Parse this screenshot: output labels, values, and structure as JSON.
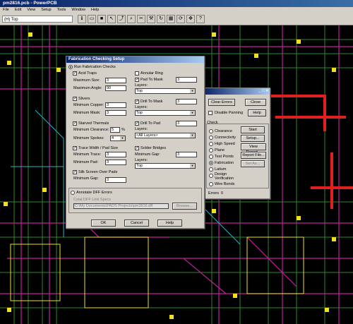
{
  "app": {
    "title": "pm2816.pcb - PowerPCB"
  },
  "menu": [
    "File",
    "Edit",
    "View",
    "Setup",
    "Tools",
    "Window",
    "Help"
  ],
  "toolbar": {
    "layer": "(H) Top"
  },
  "fab": {
    "title": "Fabrication Checking Setup",
    "run_label": "Run Fabrication Checks",
    "acid": {
      "label": "Acid Traps",
      "size_label": "Maximum Size:",
      "size": "3",
      "angle_label": "Maximum Angle:",
      "angle": "90"
    },
    "annular": {
      "label": "Annular Ring"
    },
    "pad_to_mask": {
      "label": "Pad To Mask",
      "value": "3",
      "layers_label": "Layers:",
      "layer": "Top"
    },
    "slivers": {
      "label": "Slivers",
      "copper_label": "Minimum Copper:",
      "copper": "3",
      "mask_label": "Minimum Mask:",
      "mask": "3"
    },
    "drill_to_mask": {
      "label": "Drill To Mask",
      "value": "3",
      "layers_label": "Layers:",
      "layer": "Top"
    },
    "starved": {
      "label": "Starved Thermals",
      "clear_label": "Minimum Clearance:",
      "clear": "5",
      "pct": "%",
      "spokes_label": "Minimum Spokes:",
      "spokes": "4"
    },
    "drill_to_pad": {
      "label": "Drill To Pad",
      "value": "3",
      "layers_label": "Layers:",
      "layer": "<All Layers>"
    },
    "trace": {
      "label": "Trace Width / Pad Size",
      "trace_label": "Minimum Trace:",
      "trace": "3",
      "pad_label": "Minimum Pad:",
      "pad": "3"
    },
    "bridges": {
      "label": "Solder Bridges",
      "gap_label": "Minimum Gap:",
      "gap": "3",
      "layers_label": "Layers:",
      "layer": "Top"
    },
    "silk": {
      "label": "Silk Screen Over Pads",
      "gap_label": "Minimum Gap:",
      "gap": "3"
    },
    "annotate_label": "Annotate DFF Errors",
    "dff_label": "Cstal DFF Link Specs",
    "path": "C:\\My Documents\\PADS Projects\\pm2816.dff",
    "browse": "Browse...",
    "ok": "OK",
    "cancel": "Cancel",
    "help": "Help"
  },
  "verify": {
    "clear_errors": "Clear Errors",
    "close": "Close",
    "disable_panning": "Disable Panning",
    "help": "Help",
    "check_label": "Check",
    "options": [
      "Clearance",
      "Connectivity",
      "High Speed",
      "Plane",
      "Test Points",
      "Fabrication",
      "Latium",
      "Design Verification",
      "Wire Bonds"
    ],
    "selected": "Fabrication",
    "start": "Start",
    "setup": "Setup...",
    "view_report": "View Report...",
    "report_file": "Report File...",
    "set_as": "Set As...",
    "errors_label": "Errors",
    "errors": "0"
  },
  "colors": {
    "board": "#000000",
    "trace_green": "#2a8a2a",
    "trace_magenta": "#c0209a",
    "pad_yellow": "#f0e020",
    "trace_red": "#e02020",
    "trace_cyan": "#30b0c0"
  }
}
